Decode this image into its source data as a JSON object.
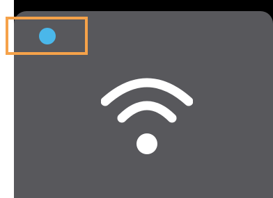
{
  "colors": {
    "frame": "#000000",
    "tile": "#58585c",
    "status_dot": "#4ab7ea",
    "highlight": "#f5a24a",
    "wifi_icon": "#ffffff"
  },
  "icons": {
    "main": "wifi-icon",
    "status": "status-dot-icon"
  }
}
